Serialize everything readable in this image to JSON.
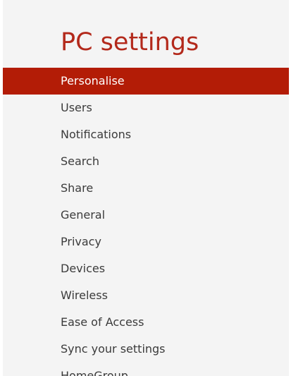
{
  "page_title": "PC settings",
  "selected_index": 0,
  "colors": {
    "title": "#b3291b",
    "selected_background": "#b31c06",
    "selected_text": "#ffffff",
    "item_text": "#3b3b3b",
    "panel_background": "#f4f4f4"
  },
  "menu": {
    "items": [
      {
        "label": "Personalise"
      },
      {
        "label": "Users"
      },
      {
        "label": "Notifications"
      },
      {
        "label": "Search"
      },
      {
        "label": "Share"
      },
      {
        "label": "General"
      },
      {
        "label": "Privacy"
      },
      {
        "label": "Devices"
      },
      {
        "label": "Wireless"
      },
      {
        "label": "Ease of Access"
      },
      {
        "label": "Sync your settings"
      },
      {
        "label": "HomeGroup"
      }
    ]
  }
}
